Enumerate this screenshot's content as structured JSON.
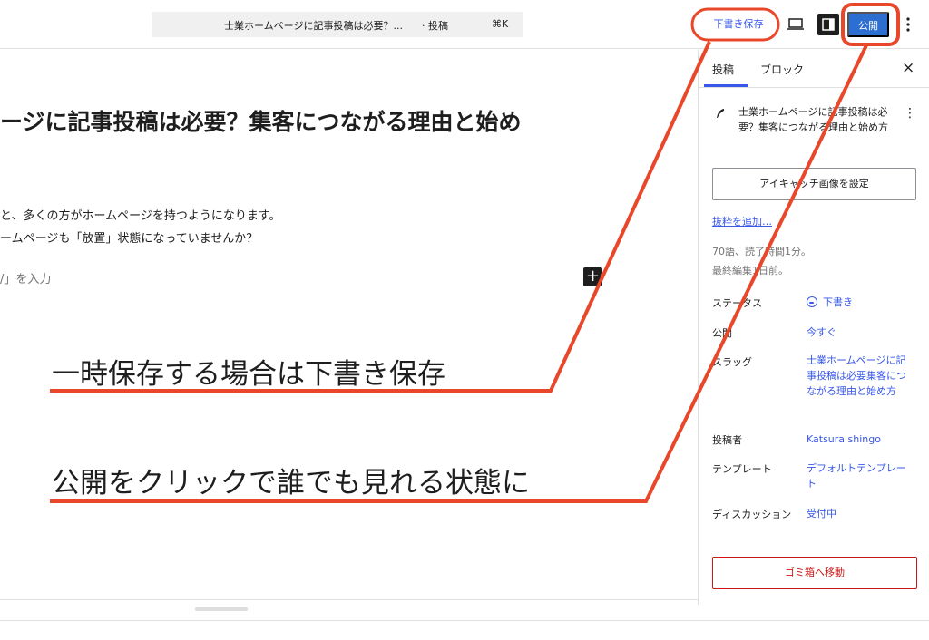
{
  "toolbar": {
    "command_title": "士業ホームページに記事投稿は必要？...",
    "command_type": "· 投稿",
    "command_shortcut": "⌘K",
    "save_draft": "下書き保存",
    "publish": "公開"
  },
  "editor": {
    "title": "ージに記事投稿は必要？集客につながる理由と始め",
    "paragraph1": "と、多くの方がホームページを持つようになります。",
    "paragraph2": "ームページも「放置」状態になっていませんか？",
    "placeholder": "/」を入力",
    "add_block": "+"
  },
  "sidebar": {
    "tabs": [
      "投稿",
      "ブロック"
    ],
    "close": "×",
    "post_summary": "士業ホームページに記事投稿は必要？集客につながる理由と始め方",
    "featured_image_button": "アイキャッチ画像を設定",
    "excerpt_link": "抜粋を追加…",
    "word_count": "70語、読了時間1分。",
    "last_edited": "最終編集1日前。",
    "rows": [
      {
        "label": "ステータス",
        "value": "下書き"
      },
      {
        "label": "公開",
        "value": "今すぐ"
      },
      {
        "label": "スラッグ",
        "value": "士業ホームページに記事投稿は必要集客につながる理由と始め方"
      },
      {
        "label": "投稿者",
        "value": "Katsura shingo"
      },
      {
        "label": "テンプレート",
        "value": "デフォルトテンプレート"
      },
      {
        "label": "ディスカッション",
        "value": "受付中"
      }
    ],
    "trash_button": "ゴミ箱へ移動"
  },
  "annotations": {
    "save_note": "一時保存する場合は下書き保存",
    "publish_note": "公開をクリックで誰でも見れる状態に"
  },
  "colors": {
    "accent": "#3858e9",
    "annotation_red": "#e8472a",
    "publish_blue": "#2d6fd1",
    "danger": "#cc1818"
  }
}
